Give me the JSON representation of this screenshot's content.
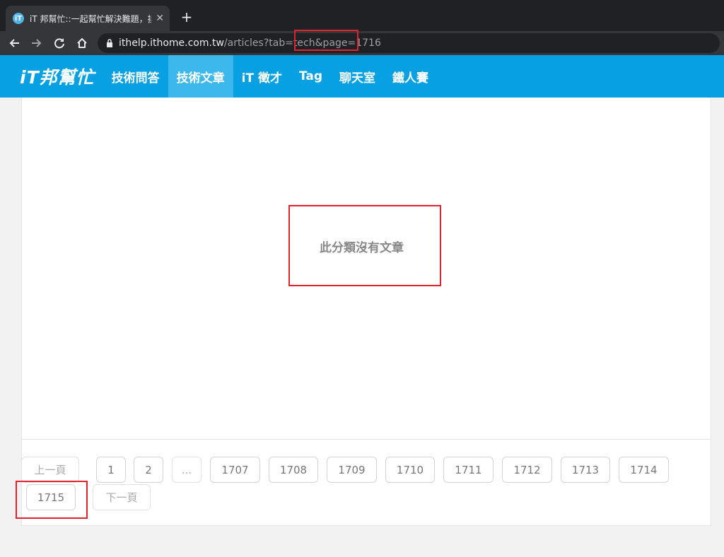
{
  "browser": {
    "tab_title": "iT 邦幫忙::一起幫忙解決難題，拯",
    "tab_close": "✕",
    "new_tab": "+",
    "url_host": "ithelp.ithome.com.tw",
    "url_path": "/articles?tab=tech",
    "url_query": "&page=1716"
  },
  "site": {
    "logo": "iT邦幫忙",
    "menu": [
      {
        "label": "技術問答"
      },
      {
        "label": "技術文章"
      },
      {
        "label": "iT 徵才"
      },
      {
        "label": "Tag"
      },
      {
        "label": "聊天室"
      },
      {
        "label": "鐵人賽"
      }
    ],
    "active_menu": "技術文章"
  },
  "content": {
    "empty_message": "此分類沒有文章"
  },
  "pagination": {
    "prev": "上一頁",
    "next": "下一頁",
    "pages": [
      "1",
      "2",
      "...",
      "1707",
      "1708",
      "1709",
      "1710",
      "1711",
      "1712",
      "1713",
      "1714",
      "1715"
    ]
  },
  "colors": {
    "brand": "#07a0e2",
    "highlight": "#e0242f"
  }
}
